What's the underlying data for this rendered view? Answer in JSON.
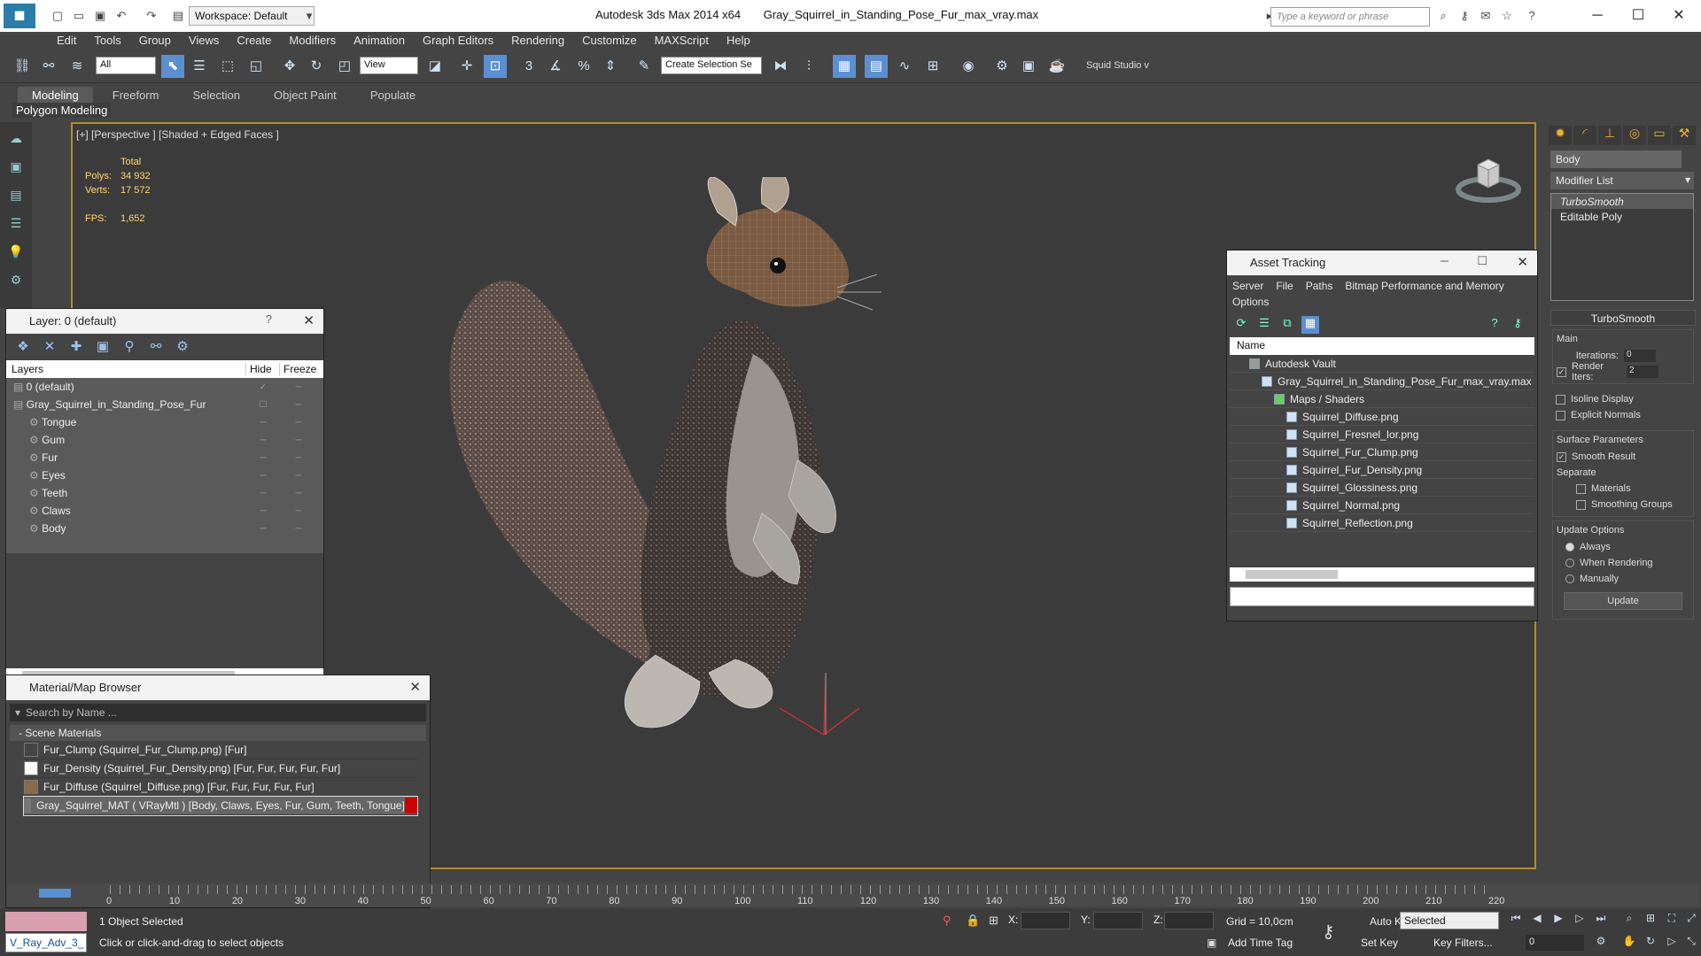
{
  "app": {
    "title_app": "Autodesk 3ds Max  2014 x64",
    "title_file": "Gray_Squirrel_in_Standing_Pose_Fur_max_vray.max",
    "workspace": "Workspace: Default",
    "search_placeholder": "Type a keyword or phrase"
  },
  "menu": [
    "Edit",
    "Tools",
    "Group",
    "Views",
    "Create",
    "Modifiers",
    "Animation",
    "Graph Editors",
    "Rendering",
    "Customize",
    "MAXScript",
    "Help"
  ],
  "toolbar": {
    "filter": "All",
    "refcoord": "View",
    "named_sel": "Create Selection Se",
    "squid": "Squid Studio v"
  },
  "ribbon": {
    "tabs": [
      "Modeling",
      "Freeform",
      "Selection",
      "Object Paint",
      "Populate"
    ],
    "active": "Modeling",
    "sub": "Polygon Modeling"
  },
  "viewport": {
    "label": "[+] [Perspective ] [Shaded + Edged Faces ]",
    "stats_header": "Total",
    "polys_label": "Polys:",
    "polys": "34 932",
    "verts_label": "Verts:",
    "verts": "17 572",
    "fps_label": "FPS:",
    "fps": "1,652"
  },
  "layers": {
    "title": "Layer: 0 (default)",
    "col_layers": "Layers",
    "col_hide": "Hide",
    "col_freeze": "Freeze",
    "rows": [
      {
        "name": "0 (default)",
        "indent": 1
      },
      {
        "name": "Gray_Squirrel_in_Standing_Pose_Fur",
        "indent": 1
      },
      {
        "name": "Tongue",
        "indent": 2
      },
      {
        "name": "Gum",
        "indent": 2
      },
      {
        "name": "Fur",
        "indent": 2
      },
      {
        "name": "Eyes",
        "indent": 2
      },
      {
        "name": "Teeth",
        "indent": 2
      },
      {
        "name": "Claws",
        "indent": 2
      },
      {
        "name": "Body",
        "indent": 2
      }
    ]
  },
  "materials": {
    "title": "Material/Map Browser",
    "search_placeholder": "Search by Name ...",
    "section": "- Scene Materials",
    "items": [
      "Fur_Clump (Squirrel_Fur_Clump.png)  [Fur]",
      "Fur_Density (Squirrel_Fur_Density.png)  [Fur, Fur, Fur, Fur, Fur]",
      "Fur_Diffuse (Squirrel_Diffuse.png)  [Fur, Fur, Fur, Fur, Fur]",
      "Gray_Squirrel_MAT  ( VRayMtl )  [Body, Claws, Eyes, Fur, Gum, Teeth, Tongue]"
    ]
  },
  "asset": {
    "title": "Asset Tracking",
    "menu": [
      "Server",
      "File",
      "Paths",
      "Bitmap Performance and Memory",
      "Options"
    ],
    "col_name": "Name",
    "tree": [
      {
        "name": "Autodesk Vault",
        "indent": 1
      },
      {
        "name": "Gray_Squirrel_in_Standing_Pose_Fur_max_vray.max",
        "indent": 2
      },
      {
        "name": "Maps / Shaders",
        "indent": 3
      },
      {
        "name": "Squirrel_Diffuse.png",
        "indent": 4
      },
      {
        "name": "Squirrel_Fresnel_Ior.png",
        "indent": 4
      },
      {
        "name": "Squirrel_Fur_Clump.png",
        "indent": 4
      },
      {
        "name": "Squirrel_Fur_Density.png",
        "indent": 4
      },
      {
        "name": "Squirrel_Glossiness.png",
        "indent": 4
      },
      {
        "name": "Squirrel_Normal.png",
        "indent": 4
      },
      {
        "name": "Squirrel_Reflection.png",
        "indent": 4
      }
    ]
  },
  "cmdpanel": {
    "object_name": "Body",
    "modifier_list": "Modifier List",
    "stack": [
      "TurboSmooth",
      "Editable Poly"
    ],
    "rollout": "TurboSmooth",
    "main": "Main",
    "iterations_label": "Iterations:",
    "iterations": "0",
    "render_iters_label": "Render Iters:",
    "render_iters": "2",
    "isoline": "Isoline Display",
    "explicit": "Explicit Normals",
    "surface": "Surface Parameters",
    "smooth": "Smooth Result",
    "separate": "Separate",
    "materials": "Materials",
    "smoothing": "Smoothing Groups",
    "update_opts": "Update Options",
    "always": "Always",
    "when_rendering": "When Rendering",
    "manually": "Manually",
    "update": "Update"
  },
  "timeline": {
    "ticks": [
      "0",
      "10",
      "20",
      "30",
      "40",
      "50",
      "60",
      "70",
      "80",
      "90",
      "100",
      "110",
      "120",
      "130",
      "140",
      "150",
      "160",
      "170",
      "180",
      "190",
      "200",
      "210",
      "220"
    ]
  },
  "status": {
    "selected": "1 Object Selected",
    "prompt": "Click or click-and-drag to select objects",
    "maxscript": "V_Ray_Adv_3_",
    "x": "X:",
    "y": "Y:",
    "z": "Z:",
    "grid": "Grid = 10,0cm",
    "add_time_tag": "Add Time Tag",
    "auto_key": "Auto Key",
    "set_key": "Set Key",
    "selected_mode": "Selected",
    "key_filters": "Key Filters...",
    "frame": "0"
  }
}
